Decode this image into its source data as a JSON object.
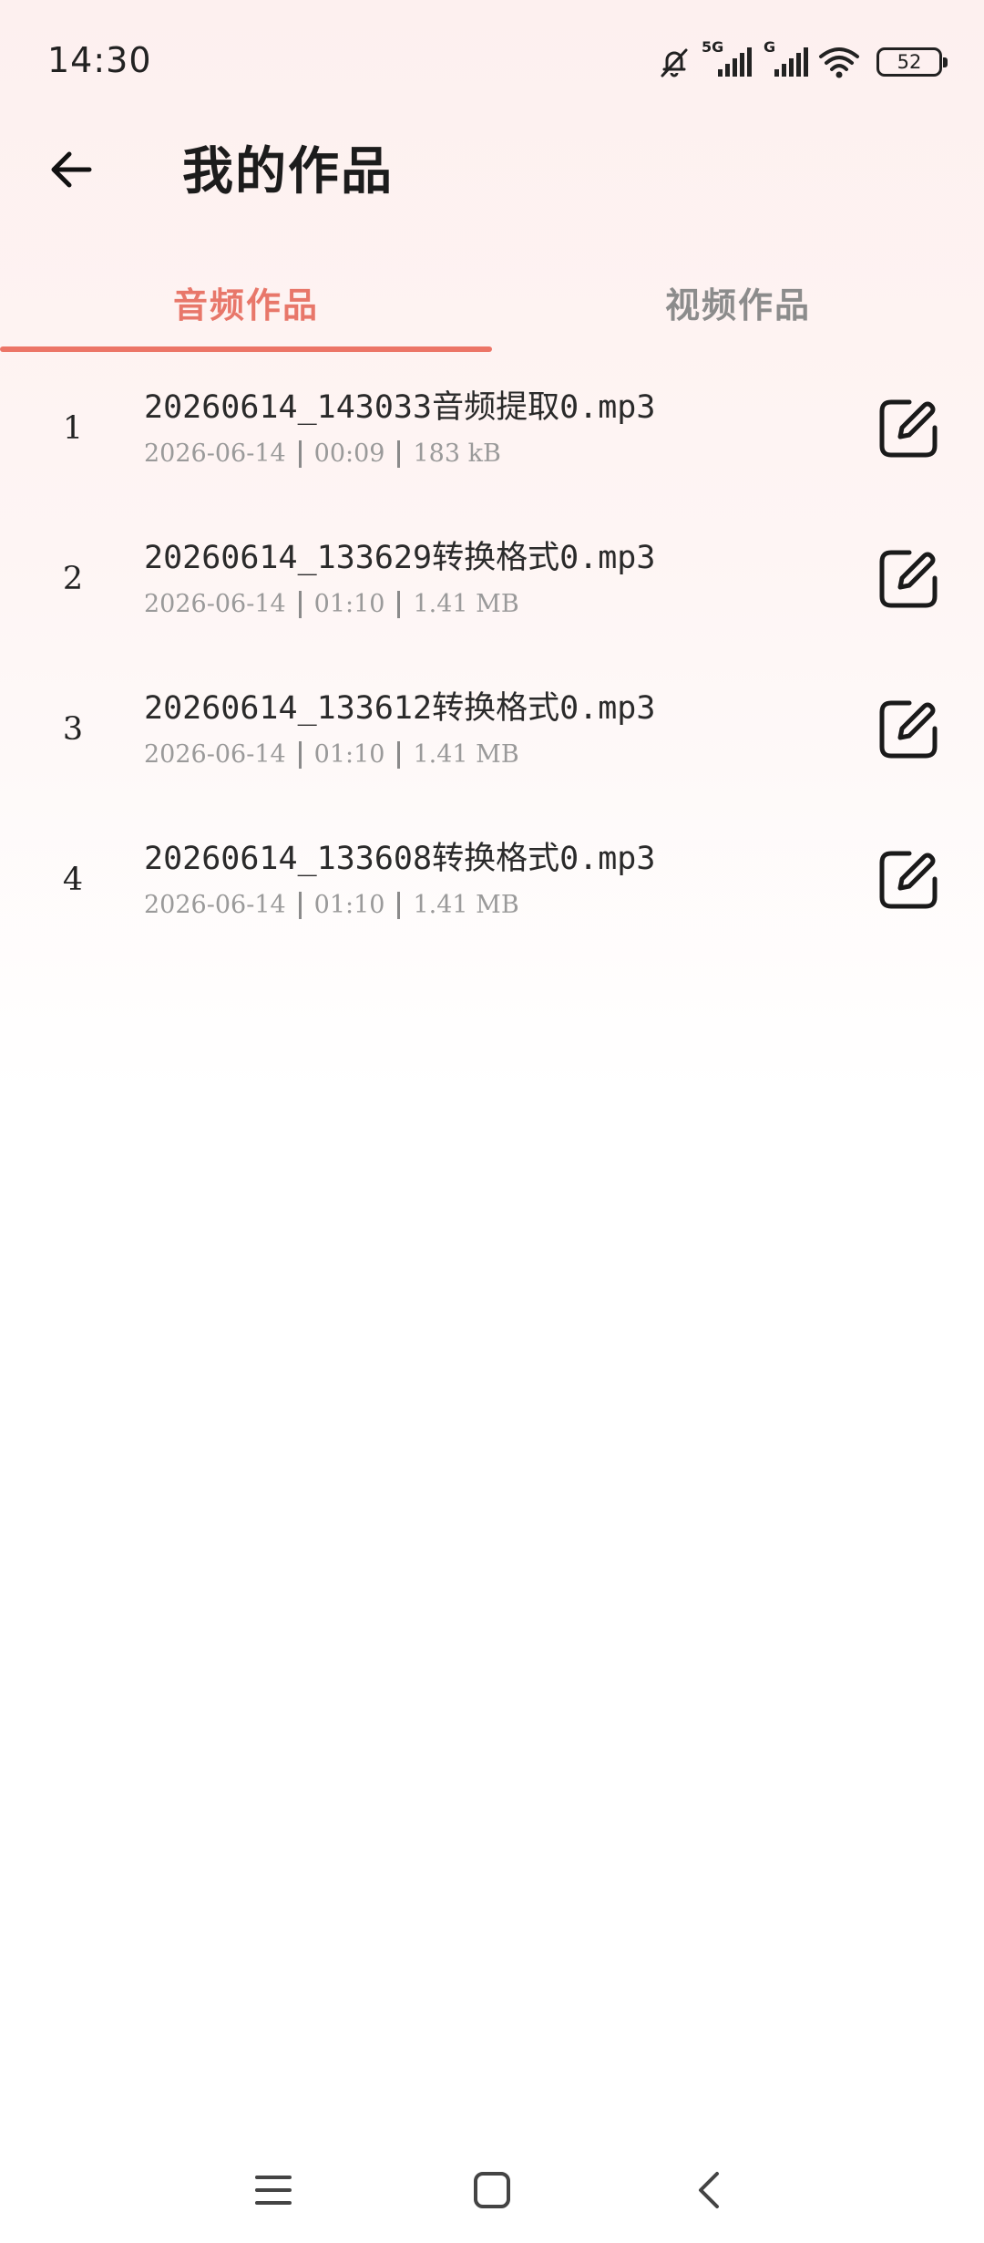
{
  "status_bar": {
    "time": "14:30",
    "network_1": "5G",
    "network_2": "G",
    "battery": "52",
    "icons": [
      "bell-off-icon",
      "signal-icon",
      "signal-icon",
      "wifi-icon",
      "battery-icon"
    ]
  },
  "header": {
    "title": "我的作品",
    "back_icon": "arrow-left-icon"
  },
  "tabs": [
    {
      "label": "音频作品",
      "active": true
    },
    {
      "label": "视频作品",
      "active": false
    }
  ],
  "colors": {
    "accent": "#ec7567",
    "inactive_tab": "#8c8c8c",
    "meta_text": "#9a9a9a"
  },
  "items": [
    {
      "index": "1",
      "name": "20260614_143033音频提取0.mp3",
      "date": "2026-06-14",
      "duration": "00:09",
      "size": "183 kB"
    },
    {
      "index": "2",
      "name": "20260614_133629转换格式0.mp3",
      "date": "2026-06-14",
      "duration": "01:10",
      "size": "1.41 MB"
    },
    {
      "index": "3",
      "name": "20260614_133612转换格式0.mp3",
      "date": "2026-06-14",
      "duration": "01:10",
      "size": "1.41 MB"
    },
    {
      "index": "4",
      "name": "20260614_133608转换格式0.mp3",
      "date": "2026-06-14",
      "duration": "01:10",
      "size": "1.41 MB"
    }
  ],
  "nav_bar": {
    "icons": [
      "menu-icon",
      "home-icon",
      "back-icon"
    ]
  }
}
